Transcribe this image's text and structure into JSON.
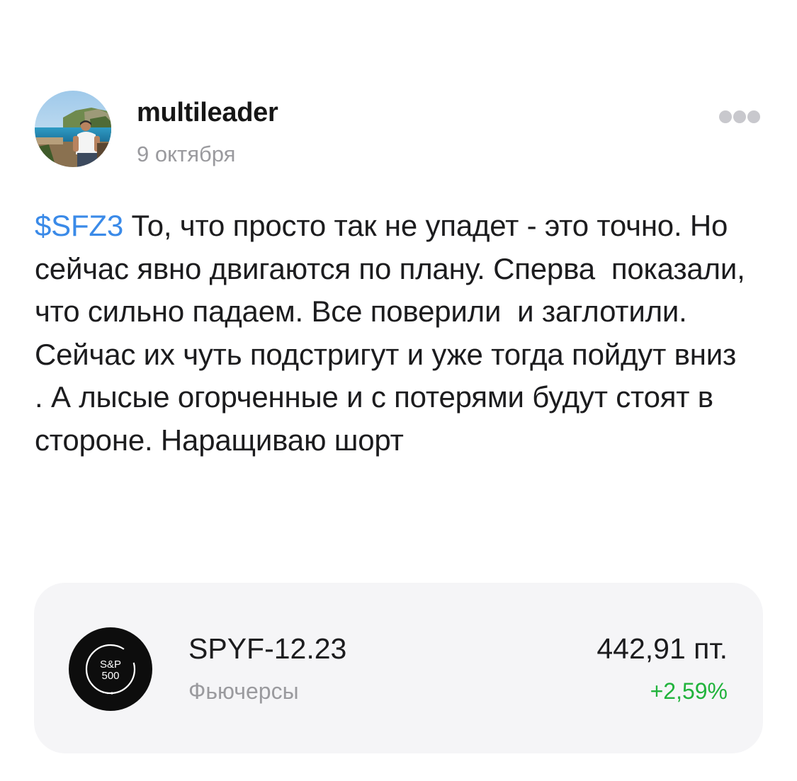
{
  "post": {
    "author": {
      "name": "multileader",
      "avatar_icon": "user-avatar-photo"
    },
    "date": "9 октября",
    "more_icon": "more-dots-icon",
    "ticker_tag": "$SFZ3",
    "text_after_tag": " То, что просто так не упадет - это точно. Но сейчас явно двигаются по плану. Сперва  показали, что сильно падаем. Все поверили  и заглотили. Сейчас их чуть подстригут и уже тогда пойдут вниз . А лысые огорченные и с потерями будут стоят в стороне. Наращиваю шорт",
    "colors": {
      "ticker_link": "#3a8ae8",
      "positive_change": "#21b33c",
      "muted_text": "#9a9a9e",
      "card_background": "#f5f5f7"
    }
  },
  "instrument_card": {
    "logo": {
      "icon": "sp500-logo-icon",
      "line1": "S&P",
      "line2": "500"
    },
    "ticker": "SPYF-12.23",
    "type": "Фьючерсы",
    "price": "442,91 пт.",
    "change": "+2,59%"
  }
}
